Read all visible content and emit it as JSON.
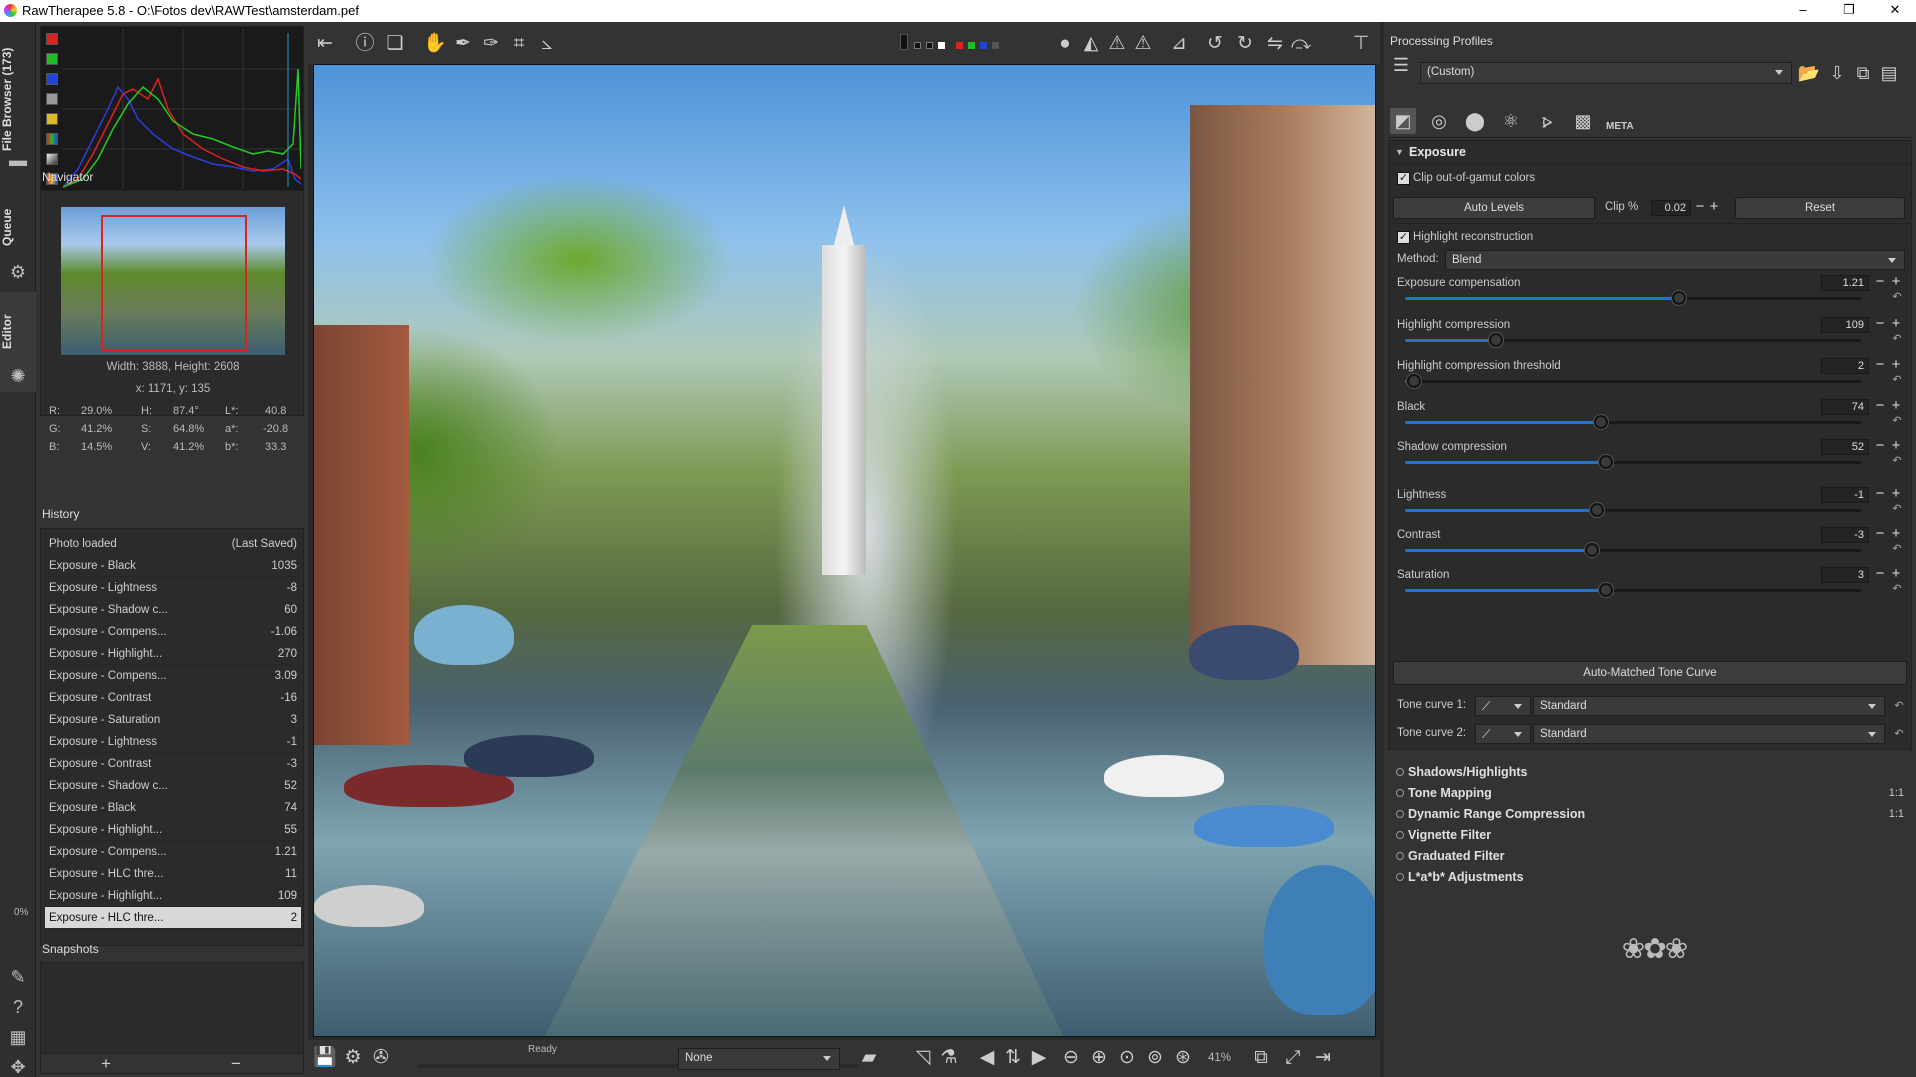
{
  "window": {
    "title": "RawTherapee 5.8 - O:\\Fotos dev\\RAWTest\\amsterdam.pef",
    "min": "–",
    "max": "❐",
    "close": "✕"
  },
  "vtabs": {
    "file_browser": "File Browser (173)",
    "queue": "Queue",
    "editor": "Editor",
    "progress": "0%"
  },
  "navigator": {
    "title": "Navigator",
    "size": "Width: 3888, Height: 2608",
    "pos": "x: 1171, y: 135",
    "r_label": "R:",
    "r": "29.0%",
    "g_label": "G:",
    "g": "41.2%",
    "b_label": "B:",
    "b": "14.5%",
    "h_label": "H:",
    "h": "87.4°",
    "s_label": "S:",
    "s": "64.8%",
    "v_label": "V:",
    "v": "41.2%",
    "l_label": "L*:",
    "l": "40.8",
    "a_label": "a*:",
    "a": "-20.8",
    "bb_label": "b*:",
    "bb": "33.3"
  },
  "history": {
    "title": "History",
    "items": [
      {
        "label": "Photo loaded",
        "value": "(Last Saved)"
      },
      {
        "label": "Exposure - Black",
        "value": "1035"
      },
      {
        "label": "Exposure - Lightness",
        "value": "-8"
      },
      {
        "label": "Exposure - Shadow c...",
        "value": "60"
      },
      {
        "label": "Exposure - Compens...",
        "value": "-1.06"
      },
      {
        "label": "Exposure - Highlight...",
        "value": "270"
      },
      {
        "label": "Exposure - Compens...",
        "value": "3.09"
      },
      {
        "label": "Exposure - Contrast",
        "value": "-16"
      },
      {
        "label": "Exposure - Saturation",
        "value": "3"
      },
      {
        "label": "Exposure - Lightness",
        "value": "-1"
      },
      {
        "label": "Exposure - Contrast",
        "value": "-3"
      },
      {
        "label": "Exposure - Shadow c...",
        "value": "52"
      },
      {
        "label": "Exposure - Black",
        "value": "74"
      },
      {
        "label": "Exposure - Highlight...",
        "value": "55"
      },
      {
        "label": "Exposure - Compens...",
        "value": "1.21"
      },
      {
        "label": "Exposure - HLC thre...",
        "value": "11"
      },
      {
        "label": "Exposure - Highlight...",
        "value": "109"
      },
      {
        "label": "Exposure - HLC thre...",
        "value": "2"
      }
    ]
  },
  "snapshots": {
    "title": "Snapshots",
    "add": "+",
    "remove": "−"
  },
  "status": {
    "ready": "Ready",
    "output_profile": "None",
    "zoom": "41%"
  },
  "profiles": {
    "title": "Processing Profiles",
    "current": "(Custom)"
  },
  "tool_tabs": {
    "meta_label": "META"
  },
  "exposure": {
    "title": "Exposure",
    "clip_gamut": "Clip out-of-gamut colors",
    "auto_levels": "Auto Levels",
    "clip_label": "Clip %",
    "clip_value": "0.02",
    "reset": "Reset",
    "hl_recon": "Highlight reconstruction",
    "method_label": "Method:",
    "method_value": "Blend",
    "sliders": [
      {
        "label": "Exposure compensation",
        "value": "1.21",
        "pos": 0.6
      },
      {
        "label": "Highlight compression",
        "value": "109",
        "pos": 0.2
      },
      {
        "label": "Highlight compression threshold",
        "value": "2",
        "pos": 0.02
      },
      {
        "label": "Black",
        "value": "74",
        "pos": 0.43
      },
      {
        "label": "Shadow compression",
        "value": "52",
        "pos": 0.44
      },
      {
        "label": "Lightness",
        "value": "-1",
        "pos": 0.42
      },
      {
        "label": "Contrast",
        "value": "-3",
        "pos": 0.41
      },
      {
        "label": "Saturation",
        "value": "3",
        "pos": 0.44
      }
    ],
    "auto_tone": "Auto-Matched Tone Curve",
    "tone1_label": "Tone curve 1:",
    "tone1_value": "Standard",
    "tone2_label": "Tone curve 2:",
    "tone2_value": "Standard"
  },
  "tools": [
    {
      "label": "Shadows/Highlights",
      "ext": ""
    },
    {
      "label": "Tone Mapping",
      "ext": "1:1"
    },
    {
      "label": "Dynamic Range Compression",
      "ext": "1:1"
    },
    {
      "label": "Vignette Filter",
      "ext": ""
    },
    {
      "label": "Graduated Filter",
      "ext": ""
    },
    {
      "label": "L*a*b* Adjustments",
      "ext": ""
    }
  ],
  "colors": {
    "accent": "#1e74c9",
    "bg": "#333333",
    "panel": "#2b2b2b"
  }
}
